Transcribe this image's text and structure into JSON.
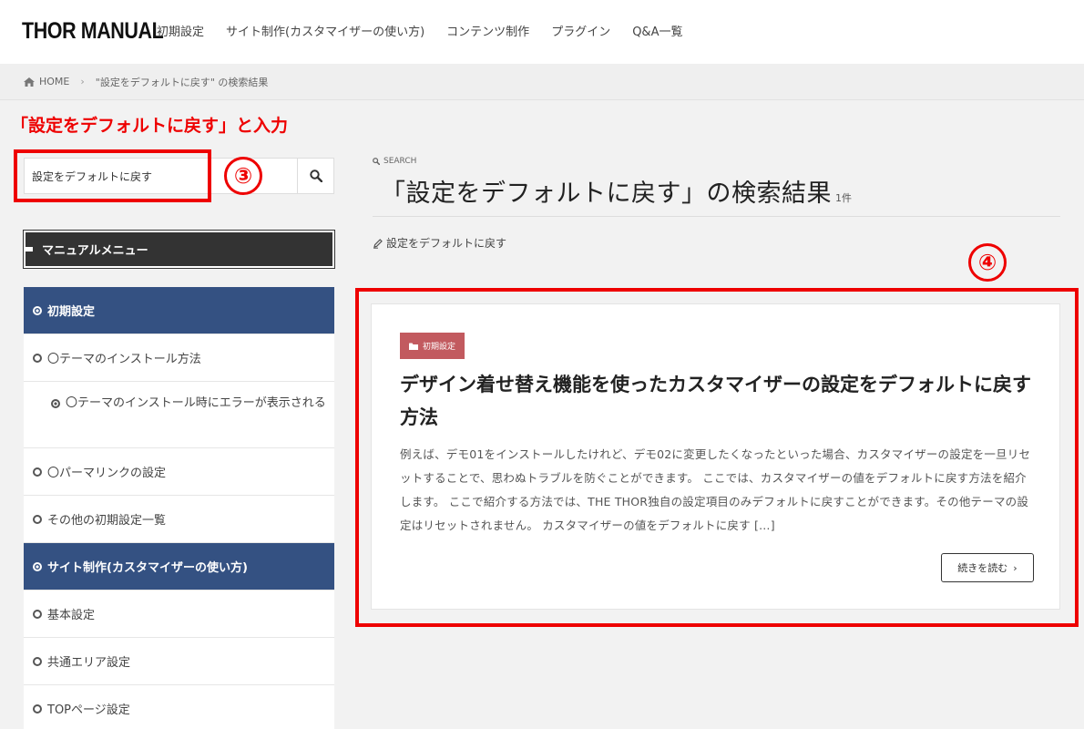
{
  "header": {
    "logo": "THOR MANUAL",
    "nav": [
      "初期設定",
      "サイト制作(カスタマイザーの使い方)",
      "コンテンツ制作",
      "プラグイン",
      "Q&A一覧"
    ]
  },
  "breadcrumb": {
    "home": "HOME",
    "current": "\"設定をデフォルトに戻す\" の検索結果"
  },
  "annotations": {
    "label": "「設定をデフォルトに戻す」と入力",
    "step3": "③",
    "step4": "④",
    "color": "#ee0000"
  },
  "sidebar": {
    "search_value": "設定をデフォルトに戻す",
    "menu_title": "マニュアルメニュー",
    "items": [
      {
        "label": "初期設定",
        "type": "cat"
      },
      {
        "label": "〇テーマのインストール方法",
        "type": "item"
      },
      {
        "label": "〇テーマのインストール時にエラーが表示される",
        "type": "sub"
      },
      {
        "label": "〇パーマリンクの設定",
        "type": "item"
      },
      {
        "label": "その他の初期設定一覧",
        "type": "item"
      },
      {
        "label": "サイト制作(カスタマイザーの使い方)",
        "type": "cat"
      },
      {
        "label": "基本設定",
        "type": "item"
      },
      {
        "label": "共通エリア設定",
        "type": "item"
      },
      {
        "label": "TOPページ設定",
        "type": "item"
      }
    ]
  },
  "main": {
    "search_label": "SEARCH",
    "title": "「設定をデフォルトに戻す」の検索結果",
    "count": "1件",
    "keyword": "設定をデフォルトに戻す",
    "card": {
      "category": "初期設定",
      "title": "デザイン着せ替え機能を使ったカスタマイザーの設定をデフォルトに戻す方法",
      "excerpt": "例えば、デモ01をインストールしたけれど、デモ02に変更したくなったといった場合、カスタマイザーの設定を一旦リセットすることで、思わぬトラブルを防ぐことができます。 ここでは、カスタマイザーの値をデフォルトに戻す方法を紹介します。 ここで紹介する方法では、THE THOR独自の設定項目のみデフォルトに戻すことができます。その他テーマの設定はリセットされません。 カスタマイザーの値をデフォルトに戻す […]",
      "read_more": "続きを読む"
    }
  },
  "colors": {
    "menu_category": "#345182",
    "badge": "#c25a5f",
    "menu_header": "#333333"
  }
}
